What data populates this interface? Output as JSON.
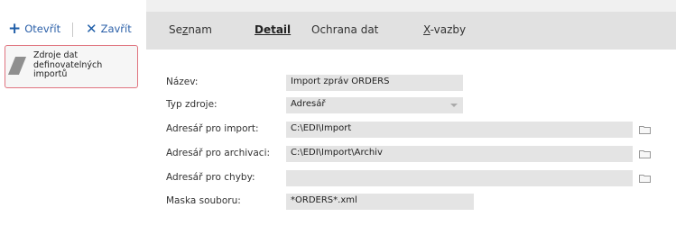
{
  "toolbar": {
    "open_label": "Otevřít",
    "open_icon": "plus-icon",
    "close_label": "Zavřít",
    "close_icon": "x-icon"
  },
  "sidebar": {
    "card": {
      "label": "Zdroje dat definovatelných importů",
      "icon": "parallelogram-icon",
      "border_color": "#e0747f"
    }
  },
  "tabs": [
    {
      "label": "Seznam",
      "hotkey_index": 2
    },
    {
      "label": "Detail",
      "active": true
    },
    {
      "label": "Ochrana dat"
    },
    {
      "label": "X-vazby"
    }
  ],
  "accent_color": "#e45b6c",
  "form": {
    "name": {
      "label": "Název:",
      "value": "Import zpráv ORDERS"
    },
    "source_type": {
      "label": "Typ zdroje:",
      "value": "Adresář"
    },
    "import_dir": {
      "label": "Adresář pro import:",
      "value": "C:\\EDI\\Import",
      "icon": "folder-icon"
    },
    "archive_dir": {
      "label": "Adresář pro archivaci:",
      "value": "C:\\EDI\\Import\\Archiv",
      "icon": "folder-icon"
    },
    "error_dir": {
      "label": "Adresář pro chyby:",
      "value": "",
      "icon": "folder-icon"
    },
    "file_mask": {
      "label": "Maska souboru:",
      "value": "*ORDERS*.xml"
    }
  }
}
